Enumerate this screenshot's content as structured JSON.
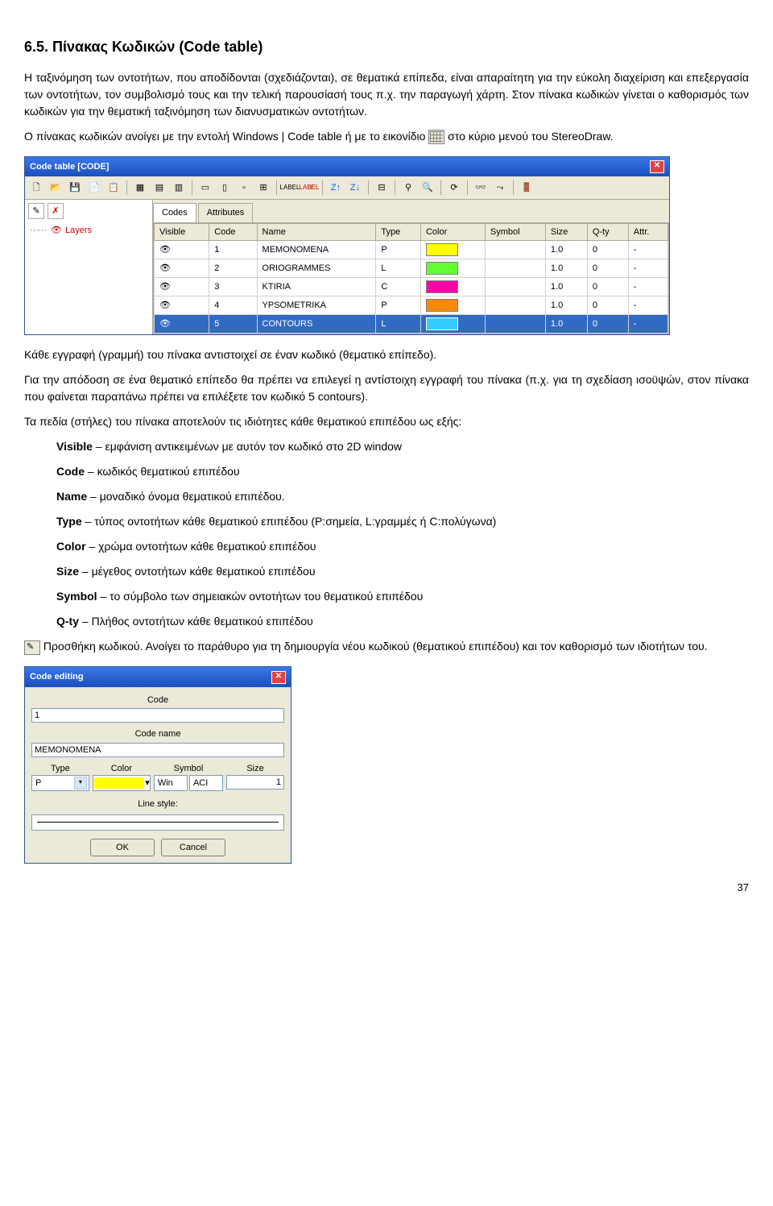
{
  "heading": "6.5. Πίνακας Κωδικών (Code table)",
  "para1": "Η ταξινόμηση των οντοτήτων, που αποδίδονται (σχεδιάζονται), σε θεματικά επίπεδα, είναι απαραίτητη για την εύκολη διαχείριση και επεξεργασία των οντοτήτων, τον συμβολισμό τους και την τελική παρουσίασή τους π.χ. την παραγωγή χάρτη. Στον πίνακα κωδικών γίνεται ο καθορισμός των κωδικών για την θεματική ταξινόμηση των διανυσματικών οντοτήτων.",
  "para2a": "Ο πίνακας κωδικών ανοίγει με την εντολή Windows | Code table ή με το εικονίδιο ",
  "para2b": " στο κύριο μενού του StereoDraw.",
  "codeTable": {
    "title": "Code table [CODE]",
    "leftPanel": {
      "layersLabel": "Layers",
      "leftButtons": [
        "✎",
        "✗"
      ]
    },
    "tabs": [
      "Codes",
      "Attributes"
    ],
    "columns": [
      "Visible",
      "Code",
      "Name",
      "Type",
      "Color",
      "Symbol",
      "Size",
      "Q-ty",
      "Attr."
    ],
    "rows": [
      {
        "code": "1",
        "name": "MEMONOMENA",
        "type": "P",
        "color": "#ffff00",
        "size": "1.0",
        "qty": "0",
        "attr": "-",
        "selected": false
      },
      {
        "code": "2",
        "name": "ORIOGRAMMES",
        "type": "L",
        "color": "#66ff33",
        "size": "1.0",
        "qty": "0",
        "attr": "-",
        "selected": false
      },
      {
        "code": "3",
        "name": "KTIRIA",
        "type": "C",
        "color": "#ff00aa",
        "size": "1.0",
        "qty": "0",
        "attr": "-",
        "selected": false
      },
      {
        "code": "4",
        "name": "YPSOMETRIKA",
        "type": "P",
        "color": "#ff8800",
        "size": "1.0",
        "qty": "0",
        "attr": "-",
        "selected": false
      },
      {
        "code": "5",
        "name": "CONTOURS",
        "type": "L",
        "color": "#33ccff",
        "size": "1.0",
        "qty": "0",
        "attr": "-",
        "selected": true
      }
    ]
  },
  "para3": "Κάθε εγγραφή (γραμμή) του πίνακα αντιστοιχεί σε έναν κωδικό (θεματικό επίπεδο).",
  "para4": "Για την απόδοση σε ένα θεματικό επίπεδο θα πρέπει να επιλεγεί η αντίστοιχη εγγραφή του πίνακα (π.χ. για τη σχεδίαση ισοϋψών, στον πίνακα που φαίνεται παραπάνω πρέπει να επιλέξετε τον κωδικό 5 contours).",
  "para5": "Τα πεδία (στήλες) του πίνακα αποτελούν τις ιδιότητες κάθε θεματικού επιπέδου ως εξής:",
  "fields": [
    {
      "name": "Visible",
      "desc": " – εμφάνιση αντικειμένων με αυτόν τον κωδικό στο 2D window"
    },
    {
      "name": "Code",
      "desc": " – κωδικός θεματικού επιπέδου"
    },
    {
      "name": "Name",
      "desc": " – μοναδικό όνομα θεματικού επιπέδου."
    },
    {
      "name": "Type",
      "desc": " – τύπος οντοτήτων κάθε θεματικού επιπέδου (P:σημεία, L:γραμμές ή C:πολύγωνα)"
    },
    {
      "name": "Color",
      "desc": " – χρώμα οντοτήτων κάθε θεματικού επιπέδου"
    },
    {
      "name": "Size",
      "desc": " – μέγεθος οντοτήτων κάθε θεματικού επιπέδου"
    },
    {
      "name": "Symbol",
      "desc": " – το σύμβολο των σημειακών οντοτήτων του θεματικού επιπέδου"
    },
    {
      "name": "Q-ty",
      "desc": " – Πλήθος οντοτήτων κάθε θεματικού επιπέδου"
    }
  ],
  "para6": " Προσθήκη κωδικού. Ανοίγει το παράθυρο για τη δημιουργία νέου κωδικού (θεματικού επιπέδου) και τον καθορισμό των ιδιοτήτων του.",
  "dialog": {
    "title": "Code editing",
    "labels": {
      "code": "Code",
      "codeName": "Code name",
      "type": "Type",
      "color": "Color",
      "symbol": "Symbol",
      "size": "Size",
      "lineStyle": "Line style:"
    },
    "values": {
      "code": "1",
      "codeName": "MEMONOMENA",
      "type": "P",
      "symbolBtns": [
        "Win",
        "ACI"
      ],
      "size": "1"
    },
    "buttons": {
      "ok": "OK",
      "cancel": "Cancel"
    }
  },
  "pageNum": "37"
}
